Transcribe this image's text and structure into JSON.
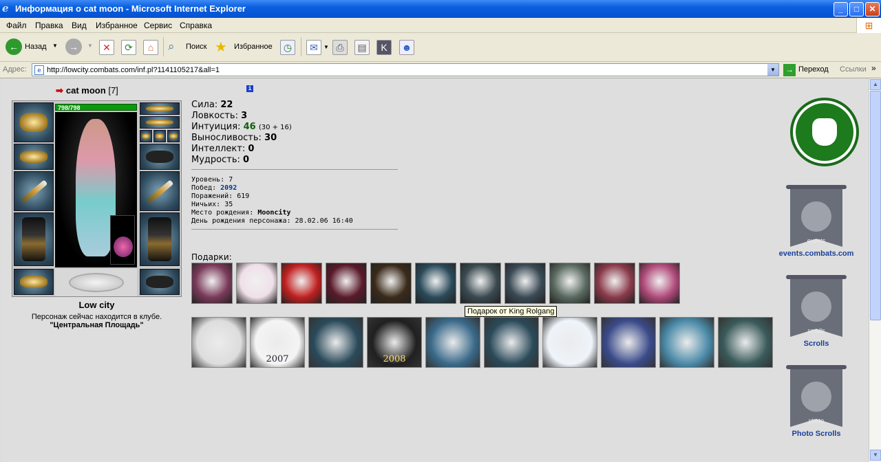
{
  "window": {
    "title": "Информация о cat moon - Microsoft Internet Explorer"
  },
  "menu": [
    "Файл",
    "Правка",
    "Вид",
    "Избранное",
    "Сервис",
    "Справка"
  ],
  "toolbar": {
    "back_label": "Назад",
    "search_label": "Поиск",
    "favorites_label": "Избранное"
  },
  "address": {
    "label": "Адрес:",
    "url": "http://lowcity.combats.com/inf.pl?1141105217&all=1",
    "go_label": "Переход",
    "links_label": "Ссылки"
  },
  "character": {
    "name": "cat moon",
    "level": "[7]",
    "hp": "798/798",
    "city": "Low city",
    "club_message": "Персонаж сейчас находится в клубе.",
    "club_name": "\"Центральная Площадь\""
  },
  "stats": {
    "strength_label": "Сила:",
    "strength": "22",
    "agility_label": "Ловкость:",
    "agility": "3",
    "intuition_label": "Интуиция:",
    "intuition": "46",
    "intuition_detail": "(30 + 16)",
    "endurance_label": "Выносливость:",
    "endurance": "30",
    "intellect_label": "Интеллект:",
    "intellect": "0",
    "wisdom_label": "Мудрость:",
    "wisdom": "0"
  },
  "info": {
    "level_label": "Уровень:",
    "level": "7",
    "wins_label": "Побед:",
    "wins": "2092",
    "losses_label": "Поражений:",
    "losses": "619",
    "draws_label": "Ничьих:",
    "draws": "35",
    "birthplace_label": "Место рождения:",
    "birthplace": "Mooncity",
    "birthday_label": "День рождения персонажа:",
    "birthday": "28.02.06 16:40"
  },
  "gifts": {
    "label": "Подарки:",
    "tooltip": "Подарок от King Rolgang",
    "row1_colors": [
      "#7a3a5a",
      "#f0e0e8",
      "#c02020",
      "#5a1a2a",
      "#3a2a1a",
      "#2a4a5a",
      "#3a4a50",
      "#3a4a55",
      "#5a6a60",
      "#8a3a4a",
      "#b04a7a"
    ],
    "row2_colors": [
      "#ddd",
      "#f4f4f4",
      "#2a4a5a",
      "#202020",
      "#3a6a8a",
      "#2a4a5a",
      "#eef4fa",
      "#3a4a8a",
      "#4a8aa8",
      "#3a5a5a"
    ],
    "year_2007": "2007",
    "year_2008": "2008"
  },
  "sidebar": {
    "events_text": "events",
    "events_link": "events.combats.com",
    "scrolls_text": "scrolls",
    "scrolls_link": "Scrolls",
    "photo_text": "photo",
    "photo_link": "Photo Scrolls"
  }
}
